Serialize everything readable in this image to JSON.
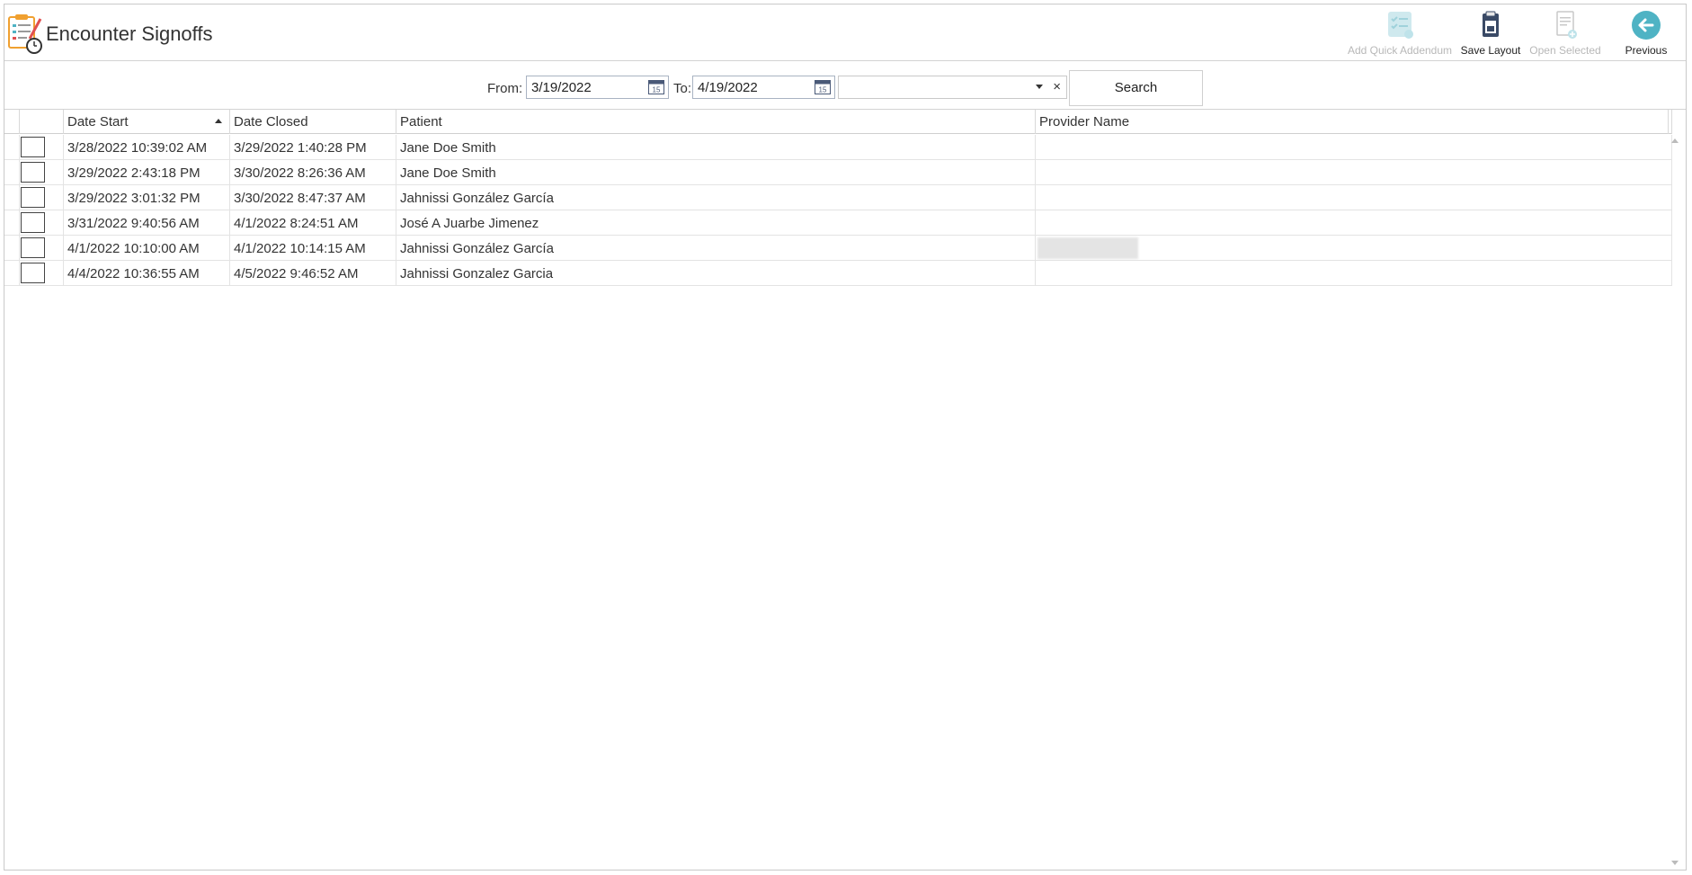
{
  "header": {
    "title": "Encounter Signoffs"
  },
  "toolbar": {
    "add_quick_addendum": "Add Quick Addendum",
    "save_layout": "Save Layout",
    "open_selected": "Open Selected",
    "previous": "Previous"
  },
  "filter": {
    "from_label": "From:",
    "from_value": "3/19/2022",
    "to_label": "To:",
    "to_value": "4/19/2022",
    "provider_value": "",
    "clear_symbol": "×",
    "search_label": "Search"
  },
  "grid": {
    "columns": [
      "Date Start",
      "Date Closed",
      "Patient",
      "Provider Name"
    ],
    "sorted_column": "Date Start",
    "sort_direction": "ascending",
    "rows": [
      {
        "date_start": "3/28/2022 10:39:02 AM",
        "date_closed": "3/29/2022 1:40:28 PM",
        "patient": "Jane  Doe Smith",
        "provider": ""
      },
      {
        "date_start": "3/29/2022 2:43:18 PM",
        "date_closed": "3/30/2022 8:26:36 AM",
        "patient": "Jane  Doe Smith",
        "provider": ""
      },
      {
        "date_start": "3/29/2022 3:01:32 PM",
        "date_closed": "3/30/2022 8:47:37 AM",
        "patient": "Jahnissi González García",
        "provider": ""
      },
      {
        "date_start": "3/31/2022 9:40:56 AM",
        "date_closed": "4/1/2022 8:24:51 AM",
        "patient": "José A Juarbe  Jimenez",
        "provider": ""
      },
      {
        "date_start": "4/1/2022 10:10:00 AM",
        "date_closed": "4/1/2022 10:14:15 AM",
        "patient": "Jahnissi González García",
        "provider": ""
      },
      {
        "date_start": "4/4/2022 10:36:55 AM",
        "date_closed": "4/5/2022 9:46:52 AM",
        "patient": "Jahnissi Gonzalez Garcia",
        "provider": ""
      }
    ]
  },
  "colors": {
    "accent_teal": "#4fb3c4",
    "disabled_text": "#b8b8b8",
    "border": "#c9c9c9"
  }
}
